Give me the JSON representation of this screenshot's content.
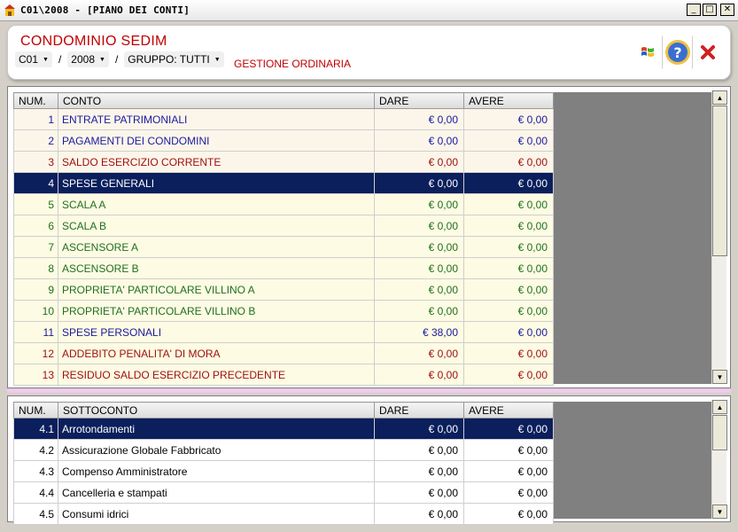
{
  "window": {
    "title": "C01\\2008 - [PIANO DEI CONTI]",
    "minimize": "_",
    "maximize": "□",
    "close": "✕"
  },
  "header": {
    "company": "CONDOMINIO SEDIM",
    "code": "C01",
    "year": "2008",
    "group": "GRUPPO: TUTTI",
    "sep": "/",
    "dropdown_arrow": "▼",
    "subtitle": "GESTIONE ORDINARIA",
    "icons": [
      "windows-icon",
      "help-icon",
      "close-icon"
    ],
    "help_glyph": "?"
  },
  "colors": {
    "accent": "#c00000",
    "blue_row": "#1a1aa0",
    "red_row": "#a01010",
    "green_row": "#207020",
    "selected_bg": "#0a1f5c",
    "row_bg_a": "#fcf6ea",
    "row_bg_b": "#fdfbe3"
  },
  "conti": {
    "columns": [
      "NUM.",
      "CONTO",
      "DARE",
      "AVERE"
    ],
    "rows": [
      {
        "num": "1",
        "name": "ENTRATE PATRIMONIALI",
        "dare": "€ 0,00",
        "avere": "€ 0,00",
        "color": "blue",
        "bg": "a",
        "selected": false
      },
      {
        "num": "2",
        "name": "PAGAMENTI DEI CONDOMINI",
        "dare": "€ 0,00",
        "avere": "€ 0,00",
        "color": "blue",
        "bg": "a",
        "selected": false
      },
      {
        "num": "3",
        "name": "SALDO ESERCIZIO CORRENTE",
        "dare": "€ 0,00",
        "avere": "€ 0,00",
        "color": "red",
        "bg": "a",
        "selected": false
      },
      {
        "num": "4",
        "name": "SPESE GENERALI",
        "dare": "€ 0,00",
        "avere": "€ 0,00",
        "color": "green",
        "bg": "b",
        "selected": true
      },
      {
        "num": "5",
        "name": "SCALA A",
        "dare": "€ 0,00",
        "avere": "€ 0,00",
        "color": "green",
        "bg": "b",
        "selected": false
      },
      {
        "num": "6",
        "name": "SCALA B",
        "dare": "€ 0,00",
        "avere": "€ 0,00",
        "color": "green",
        "bg": "b",
        "selected": false
      },
      {
        "num": "7",
        "name": "ASCENSORE A",
        "dare": "€ 0,00",
        "avere": "€ 0,00",
        "color": "green",
        "bg": "b",
        "selected": false
      },
      {
        "num": "8",
        "name": "ASCENSORE B",
        "dare": "€ 0,00",
        "avere": "€ 0,00",
        "color": "green",
        "bg": "b",
        "selected": false
      },
      {
        "num": "9",
        "name": "PROPRIETA' PARTICOLARE VILLINO A",
        "dare": "€ 0,00",
        "avere": "€ 0,00",
        "color": "green",
        "bg": "b",
        "selected": false
      },
      {
        "num": "10",
        "name": "PROPRIETA' PARTICOLARE VILLINO B",
        "dare": "€ 0,00",
        "avere": "€ 0,00",
        "color": "green",
        "bg": "b",
        "selected": false
      },
      {
        "num": "11",
        "name": "SPESE PERSONALI",
        "dare": "€ 38,00",
        "avere": "€ 0,00",
        "color": "blue",
        "bg": "b",
        "selected": false
      },
      {
        "num": "12",
        "name": "ADDEBITO PENALITA' DI MORA",
        "dare": "€ 0,00",
        "avere": "€ 0,00",
        "color": "red",
        "bg": "b",
        "selected": false
      },
      {
        "num": "13",
        "name": "RESIDUO SALDO ESERCIZIO PRECEDENTE",
        "dare": "€ 0,00",
        "avere": "€ 0,00",
        "color": "red",
        "bg": "b",
        "selected": false
      }
    ]
  },
  "sottoconti": {
    "columns": [
      "NUM.",
      "SOTTOCONTO",
      "DARE",
      "AVERE"
    ],
    "rows": [
      {
        "num": "4.1",
        "name": "Arrotondamenti",
        "dare": "€ 0,00",
        "avere": "€ 0,00",
        "selected": true
      },
      {
        "num": "4.2",
        "name": "Assicurazione Globale Fabbricato",
        "dare": "€ 0,00",
        "avere": "€ 0,00",
        "selected": false
      },
      {
        "num": "4.3",
        "name": "Compenso Amministratore",
        "dare": "€ 0,00",
        "avere": "€ 0,00",
        "selected": false
      },
      {
        "num": "4.4",
        "name": "Cancelleria e stampati",
        "dare": "€ 0,00",
        "avere": "€ 0,00",
        "selected": false
      },
      {
        "num": "4.5",
        "name": "Consumi idrici",
        "dare": "€ 0,00",
        "avere": "€ 0,00",
        "selected": false
      }
    ]
  },
  "scroll": {
    "up": "▲",
    "down": "▼"
  }
}
